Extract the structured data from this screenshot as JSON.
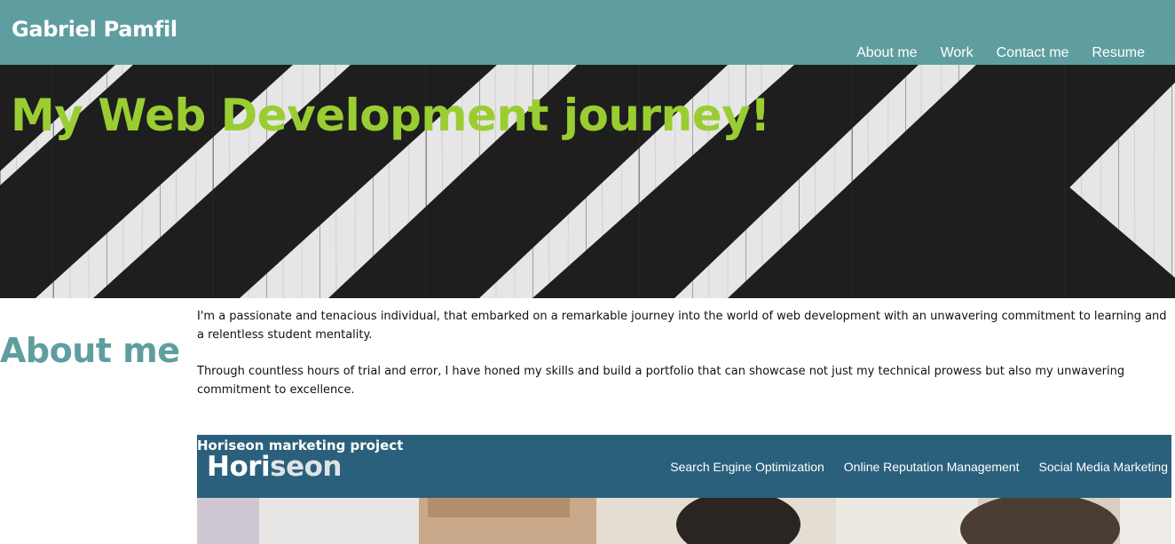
{
  "header": {
    "site_name": "Gabriel Pamfil",
    "nav": [
      "About me",
      "Work",
      "Contact me",
      "Resume"
    ]
  },
  "hero": {
    "title": "My Web Development journey!"
  },
  "about": {
    "heading": "About me",
    "paragraphs": [
      "I'm a passionate and tenacious individual, that embarked on a remarkable journey into the world of web development with an unwavering commitment to learning and a relentless student mentality.",
      "Through countless hours of trial and error, I have honed my skills and build a portfolio that can showcase not just my technical prowess but also my unwavering commitment to excellence."
    ]
  },
  "project": {
    "caption": "Horiseon marketing project",
    "logo_part1": "Hori",
    "logo_part2": "seon",
    "nav": [
      "Search Engine Optimization",
      "Online Reputation Management",
      "Social Media Marketing"
    ]
  },
  "colors": {
    "header_bg": "#5f9ea0",
    "hero_title": "#9acd32",
    "about_heading": "#5f9ea0",
    "project_bg": "#2a607c"
  }
}
